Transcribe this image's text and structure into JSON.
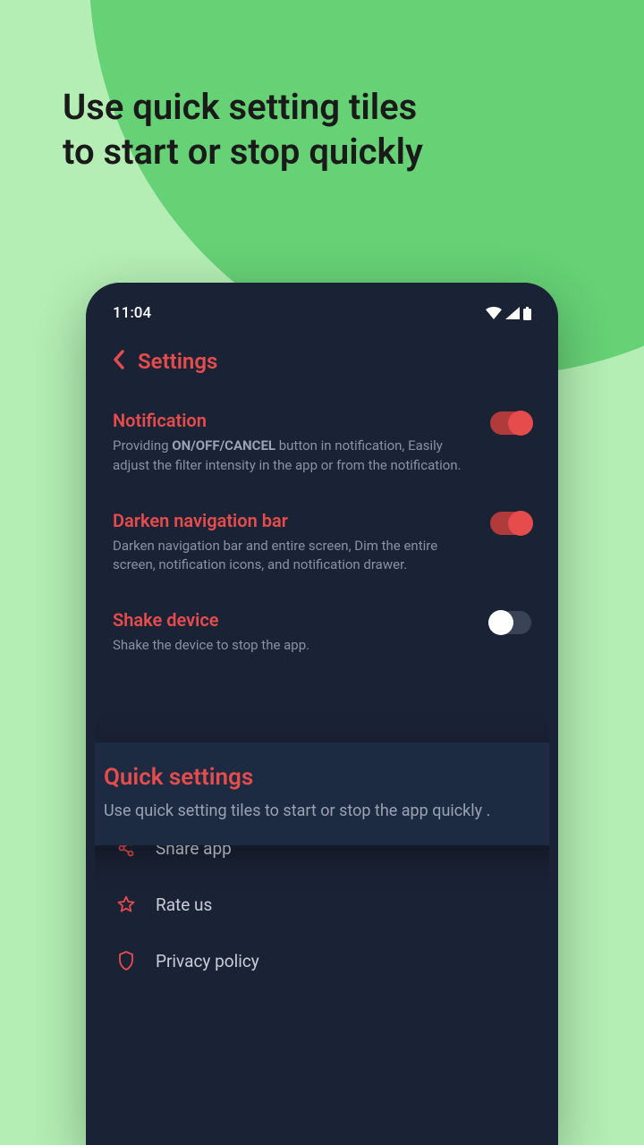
{
  "promo": {
    "line1": "Use quick setting tiles",
    "line2": "to start or stop quickly"
  },
  "status": {
    "time": "11:04"
  },
  "header": {
    "title": "Settings"
  },
  "settings": {
    "notification": {
      "title": "Notification",
      "desc_prefix": "Providing ",
      "desc_bold": "ON/OFF/CANCEL",
      "desc_suffix": " button in notification, Easily adjust the filter intensity in the app or from the notification.",
      "enabled": true
    },
    "darken_nav": {
      "title": "Darken navigation bar",
      "desc": "Darken navigation bar and entire screen, Dim the entire screen, notification icons, and notification drawer.",
      "enabled": true
    },
    "shake": {
      "title": "Shake device",
      "desc": "Shake the device to stop the app.",
      "enabled": false
    }
  },
  "highlight": {
    "title": "Quick settings",
    "desc": "Use quick setting tiles to start or stop the app quickly ."
  },
  "links": {
    "share": "Share app",
    "rate": "Rate us",
    "privacy": "Privacy policy"
  }
}
